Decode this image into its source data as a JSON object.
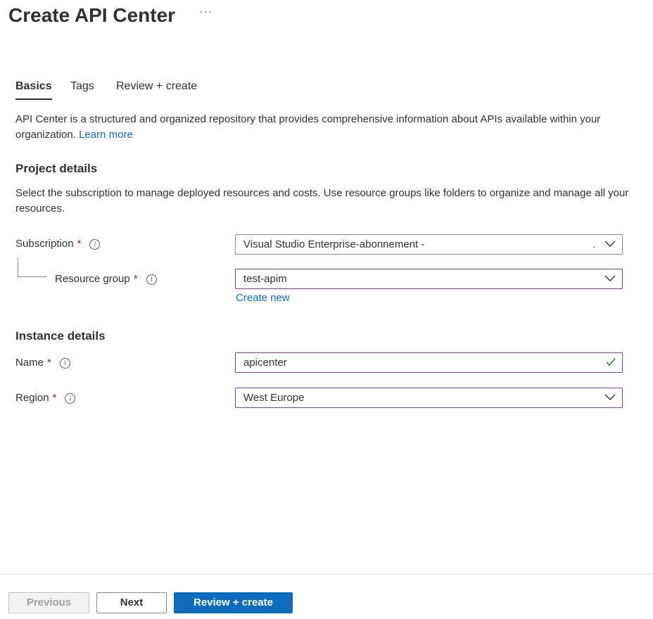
{
  "page": {
    "title": "Create API Center",
    "more_label": "···"
  },
  "tabs": [
    {
      "label": "Basics",
      "active": true
    },
    {
      "label": "Tags",
      "active": false
    },
    {
      "label": "Review + create",
      "active": false
    }
  ],
  "intro": {
    "text": "API Center is a structured and organized repository that provides comprehensive information about APIs available within your organization.",
    "link": "Learn more"
  },
  "project_details": {
    "heading": "Project details",
    "description": "Select the subscription to manage deployed resources and costs. Use resource groups like folders to organize and manage all your resources.",
    "subscription": {
      "label": "Subscription",
      "required": "*",
      "info": "i",
      "value": "Visual Studio Enterprise-abonnement -",
      "trailing": "."
    },
    "resource_group": {
      "label": "Resource group",
      "required": "*",
      "info": "i",
      "value": "test-apim",
      "create_new": "Create new"
    }
  },
  "instance_details": {
    "heading": "Instance details",
    "name": {
      "label": "Name",
      "required": "*",
      "info": "i",
      "value": "apicenter"
    },
    "region": {
      "label": "Region",
      "required": "*",
      "info": "i",
      "value": "West Europe"
    }
  },
  "footer": {
    "previous": "Previous",
    "next": "Next",
    "review_create": "Review + create"
  },
  "colors": {
    "accent": "#0f6cbd",
    "focus_border": "#7c3f9b",
    "required": "#a4262c",
    "valid_check": "#107c10"
  },
  "icons": {
    "dropdown": "chevron-down-icon",
    "valid": "checkmark-icon",
    "info": "info-icon",
    "more": "more-icon"
  }
}
